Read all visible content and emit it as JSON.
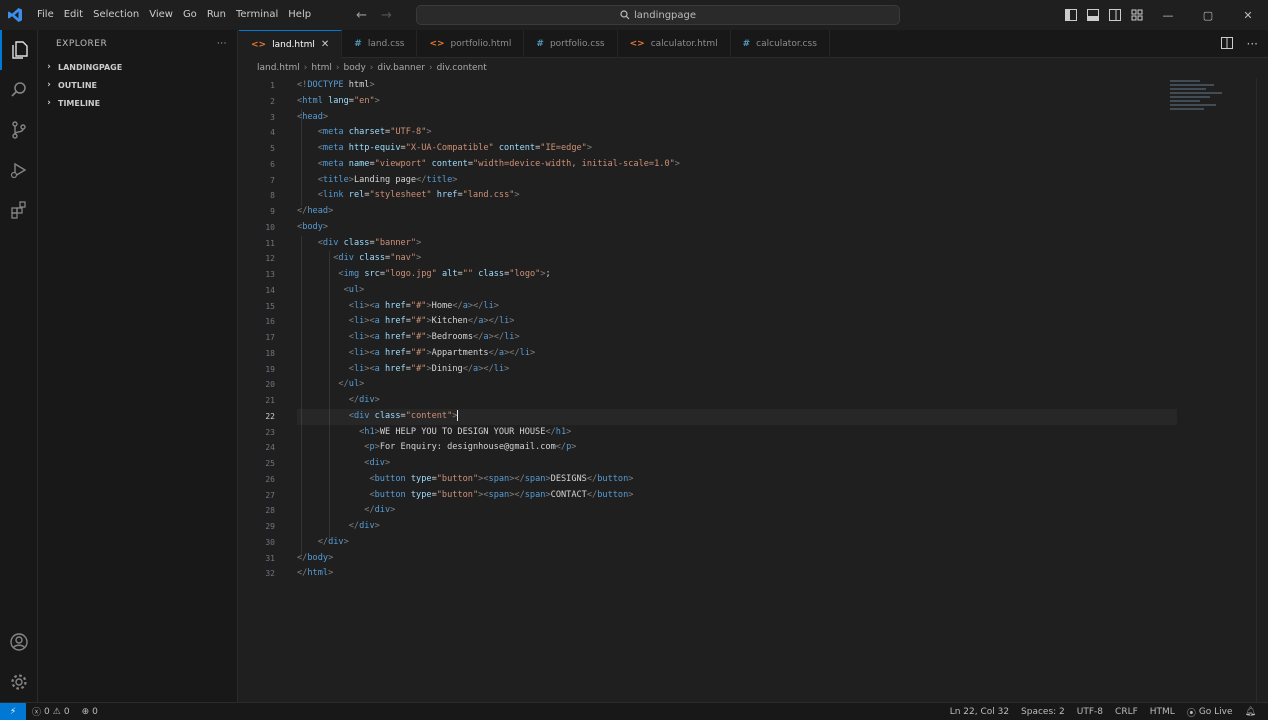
{
  "titlebar": {
    "menu": [
      "File",
      "Edit",
      "Selection",
      "View",
      "Go",
      "Run",
      "Terminal",
      "Help"
    ],
    "search_text": "landingpage",
    "back_glyph": "←",
    "forward_glyph": "→",
    "window_buttons": {
      "minimize": "—",
      "maximize": "▢",
      "close": "✕"
    }
  },
  "sidebar": {
    "title": "EXPLORER",
    "more": "···",
    "sections": [
      "LANDINGPAGE",
      "OUTLINE",
      "TIMELINE"
    ]
  },
  "tabs": [
    {
      "label": "land.html",
      "icon": "<>",
      "color": "#e37933",
      "active": true,
      "close": "✕"
    },
    {
      "label": "land.css",
      "icon": "#",
      "color": "#519aba",
      "active": false
    },
    {
      "label": "portfolio.html",
      "icon": "<>",
      "color": "#e37933",
      "active": false
    },
    {
      "label": "portfolio.css",
      "icon": "#",
      "color": "#519aba",
      "active": false
    },
    {
      "label": "calculator.html",
      "icon": "<>",
      "color": "#e37933",
      "active": false
    },
    {
      "label": "calculator.css",
      "icon": "#",
      "color": "#519aba",
      "active": false
    }
  ],
  "breadcrumb": [
    "land.html",
    "html",
    "body",
    "div.banner",
    "div.content"
  ],
  "editor": {
    "current_line": 22,
    "lines": [
      [
        [
          "brk",
          "<!"
        ],
        [
          "tag",
          "DOCTYPE"
        ],
        [
          "txt",
          " html"
        ],
        [
          "brk",
          ">"
        ]
      ],
      [
        [
          "brk",
          "<"
        ],
        [
          "tag",
          "html"
        ],
        [
          "txt",
          " "
        ],
        [
          "attr",
          "lang"
        ],
        [
          "txt",
          "="
        ],
        [
          "str",
          "\"en\""
        ],
        [
          "brk",
          ">"
        ]
      ],
      [
        [
          "brk",
          "<"
        ],
        [
          "tag",
          "head"
        ],
        [
          "brk",
          ">"
        ]
      ],
      [
        [
          "txt",
          "    "
        ],
        [
          "brk",
          "<"
        ],
        [
          "tag",
          "meta"
        ],
        [
          "txt",
          " "
        ],
        [
          "attr",
          "charset"
        ],
        [
          "txt",
          "="
        ],
        [
          "str",
          "\"UTF-8\""
        ],
        [
          "brk",
          ">"
        ]
      ],
      [
        [
          "txt",
          "    "
        ],
        [
          "brk",
          "<"
        ],
        [
          "tag",
          "meta"
        ],
        [
          "txt",
          " "
        ],
        [
          "attr",
          "http-equiv"
        ],
        [
          "txt",
          "="
        ],
        [
          "str",
          "\"X-UA-Compatible\""
        ],
        [
          "txt",
          " "
        ],
        [
          "attr",
          "content"
        ],
        [
          "txt",
          "="
        ],
        [
          "str",
          "\"IE=edge\""
        ],
        [
          "brk",
          ">"
        ]
      ],
      [
        [
          "txt",
          "    "
        ],
        [
          "brk",
          "<"
        ],
        [
          "tag",
          "meta"
        ],
        [
          "txt",
          " "
        ],
        [
          "attr",
          "name"
        ],
        [
          "txt",
          "="
        ],
        [
          "str",
          "\"viewport\""
        ],
        [
          "txt",
          " "
        ],
        [
          "attr",
          "content"
        ],
        [
          "txt",
          "="
        ],
        [
          "str",
          "\"width=device-width, initial-scale=1.0\""
        ],
        [
          "brk",
          ">"
        ]
      ],
      [
        [
          "txt",
          "    "
        ],
        [
          "brk",
          "<"
        ],
        [
          "tag",
          "title"
        ],
        [
          "brk",
          ">"
        ],
        [
          "txt",
          "Landing page"
        ],
        [
          "brk",
          "</"
        ],
        [
          "tag",
          "title"
        ],
        [
          "brk",
          ">"
        ]
      ],
      [
        [
          "txt",
          "    "
        ],
        [
          "brk",
          "<"
        ],
        [
          "tag",
          "link"
        ],
        [
          "txt",
          " "
        ],
        [
          "attr",
          "rel"
        ],
        [
          "txt",
          "="
        ],
        [
          "str",
          "\"stylesheet\""
        ],
        [
          "txt",
          " "
        ],
        [
          "attr",
          "href"
        ],
        [
          "txt",
          "="
        ],
        [
          "str",
          "\"land.css\""
        ],
        [
          "brk",
          ">"
        ]
      ],
      [
        [
          "brk",
          "</"
        ],
        [
          "tag",
          "head"
        ],
        [
          "brk",
          ">"
        ]
      ],
      [
        [
          "brk",
          "<"
        ],
        [
          "tag",
          "body"
        ],
        [
          "brk",
          ">"
        ]
      ],
      [
        [
          "txt",
          "    "
        ],
        [
          "brk",
          "<"
        ],
        [
          "tag",
          "div"
        ],
        [
          "txt",
          " "
        ],
        [
          "attr",
          "class"
        ],
        [
          "txt",
          "="
        ],
        [
          "str",
          "\"banner\""
        ],
        [
          "brk",
          ">"
        ]
      ],
      [
        [
          "txt",
          "       "
        ],
        [
          "brk",
          "<"
        ],
        [
          "tag",
          "div"
        ],
        [
          "txt",
          " "
        ],
        [
          "attr",
          "class"
        ],
        [
          "txt",
          "="
        ],
        [
          "str",
          "\"nav\""
        ],
        [
          "brk",
          ">"
        ]
      ],
      [
        [
          "txt",
          "        "
        ],
        [
          "brk",
          "<"
        ],
        [
          "tag",
          "img"
        ],
        [
          "txt",
          " "
        ],
        [
          "attr",
          "src"
        ],
        [
          "txt",
          "="
        ],
        [
          "str",
          "\"logo.jpg\""
        ],
        [
          "txt",
          " "
        ],
        [
          "attr",
          "alt"
        ],
        [
          "txt",
          "="
        ],
        [
          "str",
          "\"\""
        ],
        [
          "txt",
          " "
        ],
        [
          "attr",
          "class"
        ],
        [
          "txt",
          "="
        ],
        [
          "str",
          "\"logo\""
        ],
        [
          "brk",
          ">"
        ],
        [
          "txt",
          ";"
        ]
      ],
      [
        [
          "txt",
          "         "
        ],
        [
          "brk",
          "<"
        ],
        [
          "tag",
          "ul"
        ],
        [
          "brk",
          ">"
        ]
      ],
      [
        [
          "txt",
          "          "
        ],
        [
          "brk",
          "<"
        ],
        [
          "tag",
          "li"
        ],
        [
          "brk",
          "><"
        ],
        [
          "tag",
          "a"
        ],
        [
          "txt",
          " "
        ],
        [
          "attr",
          "href"
        ],
        [
          "txt",
          "="
        ],
        [
          "str",
          "\"#\""
        ],
        [
          "brk",
          ">"
        ],
        [
          "txt",
          "Home"
        ],
        [
          "brk",
          "</"
        ],
        [
          "tag",
          "a"
        ],
        [
          "brk",
          "></"
        ],
        [
          "tag",
          "li"
        ],
        [
          "brk",
          ">"
        ]
      ],
      [
        [
          "txt",
          "          "
        ],
        [
          "brk",
          "<"
        ],
        [
          "tag",
          "li"
        ],
        [
          "brk",
          "><"
        ],
        [
          "tag",
          "a"
        ],
        [
          "txt",
          " "
        ],
        [
          "attr",
          "href"
        ],
        [
          "txt",
          "="
        ],
        [
          "str",
          "\"#\""
        ],
        [
          "brk",
          ">"
        ],
        [
          "txt",
          "Kitchen"
        ],
        [
          "brk",
          "</"
        ],
        [
          "tag",
          "a"
        ],
        [
          "brk",
          "></"
        ],
        [
          "tag",
          "li"
        ],
        [
          "brk",
          ">"
        ]
      ],
      [
        [
          "txt",
          "          "
        ],
        [
          "brk",
          "<"
        ],
        [
          "tag",
          "li"
        ],
        [
          "brk",
          "><"
        ],
        [
          "tag",
          "a"
        ],
        [
          "txt",
          " "
        ],
        [
          "attr",
          "href"
        ],
        [
          "txt",
          "="
        ],
        [
          "str",
          "\"#\""
        ],
        [
          "brk",
          ">"
        ],
        [
          "txt",
          "Bedrooms"
        ],
        [
          "brk",
          "</"
        ],
        [
          "tag",
          "a"
        ],
        [
          "brk",
          "></"
        ],
        [
          "tag",
          "li"
        ],
        [
          "brk",
          ">"
        ]
      ],
      [
        [
          "txt",
          "          "
        ],
        [
          "brk",
          "<"
        ],
        [
          "tag",
          "li"
        ],
        [
          "brk",
          "><"
        ],
        [
          "tag",
          "a"
        ],
        [
          "txt",
          " "
        ],
        [
          "attr",
          "href"
        ],
        [
          "txt",
          "="
        ],
        [
          "str",
          "\"#\""
        ],
        [
          "brk",
          ">"
        ],
        [
          "txt",
          "Appartments"
        ],
        [
          "brk",
          "</"
        ],
        [
          "tag",
          "a"
        ],
        [
          "brk",
          "></"
        ],
        [
          "tag",
          "li"
        ],
        [
          "brk",
          ">"
        ]
      ],
      [
        [
          "txt",
          "          "
        ],
        [
          "brk",
          "<"
        ],
        [
          "tag",
          "li"
        ],
        [
          "brk",
          "><"
        ],
        [
          "tag",
          "a"
        ],
        [
          "txt",
          " "
        ],
        [
          "attr",
          "href"
        ],
        [
          "txt",
          "="
        ],
        [
          "str",
          "\"#\""
        ],
        [
          "brk",
          ">"
        ],
        [
          "txt",
          "Dining"
        ],
        [
          "brk",
          "</"
        ],
        [
          "tag",
          "a"
        ],
        [
          "brk",
          "></"
        ],
        [
          "tag",
          "li"
        ],
        [
          "brk",
          ">"
        ]
      ],
      [
        [
          "txt",
          "        "
        ],
        [
          "brk",
          "</"
        ],
        [
          "tag",
          "ul"
        ],
        [
          "brk",
          ">"
        ]
      ],
      [
        [
          "txt",
          "          "
        ],
        [
          "brk",
          "</"
        ],
        [
          "tag",
          "div"
        ],
        [
          "brk",
          ">"
        ]
      ],
      [
        [
          "txt",
          "          "
        ],
        [
          "brk",
          "<"
        ],
        [
          "tag",
          "div"
        ],
        [
          "txt",
          " "
        ],
        [
          "attr",
          "class"
        ],
        [
          "txt",
          "="
        ],
        [
          "str",
          "\"content\""
        ],
        [
          "brk",
          ">"
        ],
        [
          "cursor",
          ""
        ]
      ],
      [
        [
          "txt",
          "            "
        ],
        [
          "brk",
          "<"
        ],
        [
          "tag",
          "h1"
        ],
        [
          "brk",
          ">"
        ],
        [
          "txt",
          "WE HELP YOU TO DESIGN YOUR HOUSE"
        ],
        [
          "brk",
          "</"
        ],
        [
          "tag",
          "h1"
        ],
        [
          "brk",
          ">"
        ]
      ],
      [
        [
          "txt",
          "             "
        ],
        [
          "brk",
          "<"
        ],
        [
          "tag",
          "p"
        ],
        [
          "brk",
          ">"
        ],
        [
          "txt",
          "For Enquiry: designhouse@gmail.com"
        ],
        [
          "brk",
          "</"
        ],
        [
          "tag",
          "p"
        ],
        [
          "brk",
          ">"
        ]
      ],
      [
        [
          "txt",
          "             "
        ],
        [
          "brk",
          "<"
        ],
        [
          "tag",
          "div"
        ],
        [
          "brk",
          ">"
        ]
      ],
      [
        [
          "txt",
          "              "
        ],
        [
          "brk",
          "<"
        ],
        [
          "tag",
          "button"
        ],
        [
          "txt",
          " "
        ],
        [
          "attr",
          "type"
        ],
        [
          "txt",
          "="
        ],
        [
          "str",
          "\"button\""
        ],
        [
          "brk",
          "><"
        ],
        [
          "tag",
          "span"
        ],
        [
          "brk",
          "></"
        ],
        [
          "tag",
          "span"
        ],
        [
          "brk",
          ">"
        ],
        [
          "txt",
          "DESIGNS"
        ],
        [
          "brk",
          "</"
        ],
        [
          "tag",
          "button"
        ],
        [
          "brk",
          ">"
        ]
      ],
      [
        [
          "txt",
          "              "
        ],
        [
          "brk",
          "<"
        ],
        [
          "tag",
          "button"
        ],
        [
          "txt",
          " "
        ],
        [
          "attr",
          "type"
        ],
        [
          "txt",
          "="
        ],
        [
          "str",
          "\"button\""
        ],
        [
          "brk",
          "><"
        ],
        [
          "tag",
          "span"
        ],
        [
          "brk",
          "></"
        ],
        [
          "tag",
          "span"
        ],
        [
          "brk",
          ">"
        ],
        [
          "txt",
          "CONTACT"
        ],
        [
          "brk",
          "</"
        ],
        [
          "tag",
          "button"
        ],
        [
          "brk",
          ">"
        ]
      ],
      [
        [
          "txt",
          "             "
        ],
        [
          "brk",
          "</"
        ],
        [
          "tag",
          "div"
        ],
        [
          "brk",
          ">"
        ]
      ],
      [
        [
          "txt",
          "          "
        ],
        [
          "brk",
          "</"
        ],
        [
          "tag",
          "div"
        ],
        [
          "brk",
          ">"
        ]
      ],
      [
        [
          "txt",
          "    "
        ],
        [
          "brk",
          "</"
        ],
        [
          "tag",
          "div"
        ],
        [
          "brk",
          ">"
        ]
      ],
      [
        [
          "brk",
          "</"
        ],
        [
          "tag",
          "body"
        ],
        [
          "brk",
          ">"
        ]
      ],
      [
        [
          "brk",
          "</"
        ],
        [
          "tag",
          "html"
        ],
        [
          "brk",
          ">"
        ]
      ]
    ]
  },
  "statusbar": {
    "remote": "⚡",
    "errors": "0",
    "warnings": "0",
    "ports": "0",
    "position": "Ln 22, Col 32",
    "spaces": "Spaces: 2",
    "encoding": "UTF-8",
    "eol": "CRLF",
    "language": "HTML",
    "golive": "Go Live"
  },
  "colors": {
    "accent": "#0078d4",
    "html_icon": "#e37933",
    "css_icon": "#519aba"
  }
}
